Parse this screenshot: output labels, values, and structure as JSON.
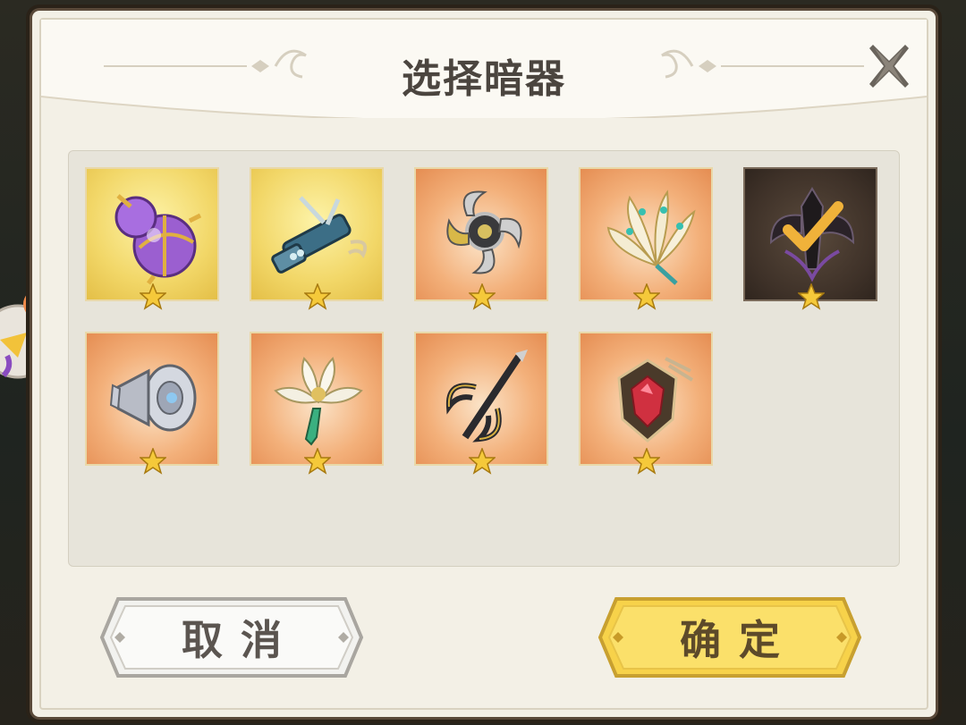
{
  "dialog": {
    "title": "选择暗器",
    "close_icon": "close-x-icon"
  },
  "items": [
    {
      "name": "purple-gourd-bomb-icon",
      "rarity": "gold",
      "stars": 1,
      "selected": false
    },
    {
      "name": "crossbow-launcher-icon",
      "rarity": "gold",
      "stars": 1,
      "selected": false
    },
    {
      "name": "crescent-blade-wheel-icon",
      "rarity": "orange",
      "stars": 1,
      "selected": false
    },
    {
      "name": "feather-fan-icon",
      "rarity": "orange",
      "stars": 1,
      "selected": false
    },
    {
      "name": "dark-claw-weapon-icon",
      "rarity": "selected",
      "stars": 1,
      "selected": true
    },
    {
      "name": "steel-wheel-icon",
      "rarity": "orange",
      "stars": 1,
      "selected": false
    },
    {
      "name": "lotus-flower-icon",
      "rarity": "orange",
      "stars": 1,
      "selected": false
    },
    {
      "name": "trident-claw-icon",
      "rarity": "orange",
      "stars": 1,
      "selected": false
    },
    {
      "name": "ruby-lantern-icon",
      "rarity": "orange",
      "stars": 1,
      "selected": false
    }
  ],
  "buttons": {
    "cancel_label": "取消",
    "confirm_label": "确定"
  },
  "colors": {
    "gold_card": "#f2d768",
    "orange_card": "#f3b07a",
    "selected_card": "#3e3128",
    "confirm_button": "#f7d24a",
    "star": "#f5c93a",
    "check": "#f0b23a"
  }
}
